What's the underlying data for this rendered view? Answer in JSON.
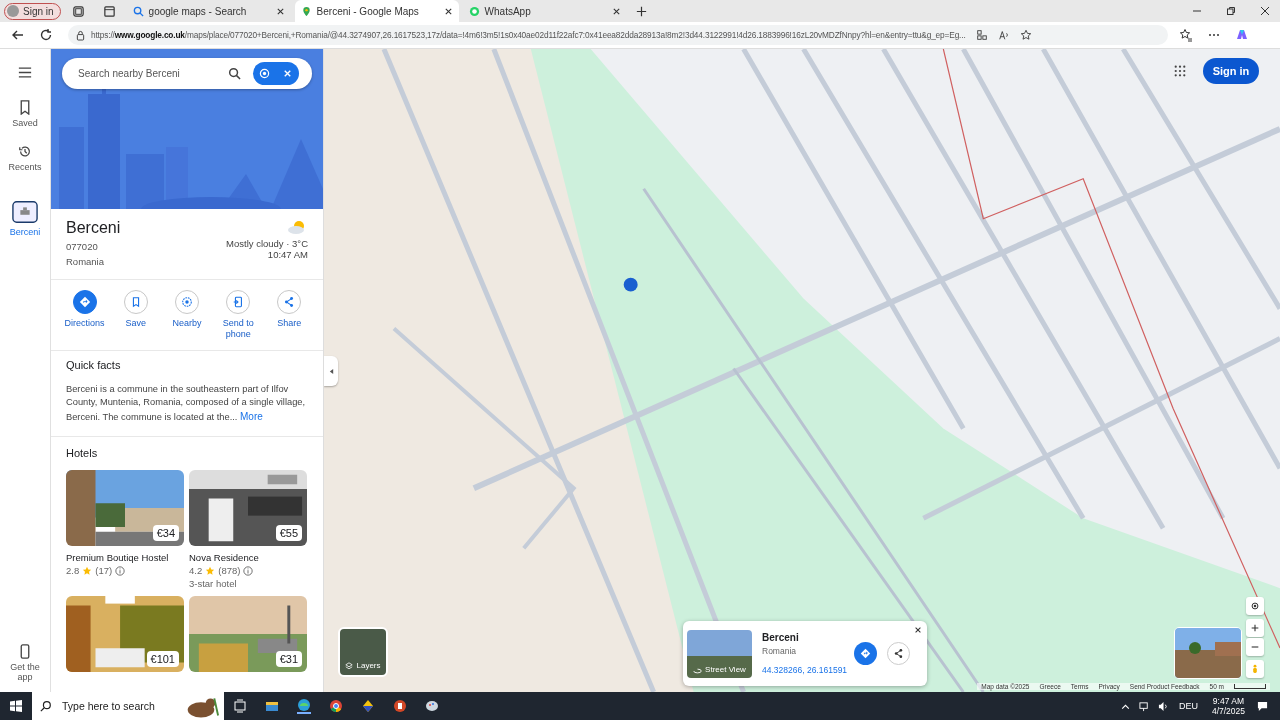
{
  "browser": {
    "profile": "Sign in",
    "tabs": [
      {
        "title": "google maps - Search",
        "kind": "search",
        "selected": false
      },
      {
        "title": "Berceni - Google Maps",
        "kind": "maps",
        "selected": true
      },
      {
        "title": "WhatsApp",
        "kind": "chat",
        "selected": false
      }
    ],
    "url": "https://**www.google.co.uk**/maps/place/077020+Berceni,+Romania/@44.3274907,26.1617523,17z/data=!4m6!3m5!1s0x40ae02d11f22afc7:0x41eea82dda28913a!8m2!3d44.3122991!4d26.1883996!16zL20vMDZfNnpy?hl=en&entry=ttu&g_ep=Eg..."
  },
  "rail": {
    "items": [
      {
        "label": "Saved",
        "kind": "saved",
        "selected": false
      },
      {
        "label": "Recents",
        "kind": "recents",
        "selected": false
      },
      {
        "label": "Berceni",
        "kind": "place",
        "selected": true
      }
    ],
    "get_app": "Get the app"
  },
  "panel": {
    "search": {
      "placeholder": "Search nearby Berceni"
    },
    "place": {
      "name": "Berceni",
      "postcode": "077020",
      "country": "Romania",
      "weather": "Mostly cloudy · 3°C",
      "time": "10:47 AM"
    },
    "actions": [
      {
        "label": "Directions",
        "kind": "directions",
        "primary": true
      },
      {
        "label": "Save",
        "kind": "save",
        "primary": false
      },
      {
        "label": "Nearby",
        "kind": "nearby",
        "primary": false
      },
      {
        "label": "Send to phone",
        "kind": "phone",
        "primary": false
      },
      {
        "label": "Share",
        "kind": "share",
        "primary": false
      }
    ],
    "quick_facts": {
      "title": "Quick facts",
      "text": "Berceni is a commune in the southeastern part of Ilfov County, Muntenia, Romania, composed of a single village, Berceni. The commune is located at the...",
      "more": "More"
    },
    "hotels": {
      "title": "Hotels",
      "items": [
        {
          "name": "Premium Boutiqe Hostel",
          "rating": "2.8",
          "reviews": "(17)",
          "price": "€34"
        },
        {
          "name": "Nova Residence",
          "rating": "4.2",
          "reviews": "(878)",
          "class": "3-star hotel",
          "price": "€55"
        },
        {
          "price": "€101"
        },
        {
          "price": "€31"
        }
      ]
    }
  },
  "map": {
    "sign_in": "Sign in",
    "layers": "Layers",
    "card": {
      "title": "Berceni",
      "subtitle": "Romania",
      "coords": "44.328266, 26.161591",
      "street_view": "Street View"
    },
    "footer": [
      "Map data ©2025",
      "Greece",
      "Terms",
      "Privacy",
      "Send Product Feedback",
      "50 m"
    ]
  },
  "taskbar": {
    "search": {
      "placeholder": "Type here to search"
    },
    "language": "DEU",
    "time": "9:47 AM",
    "date": "4/7/2025"
  }
}
